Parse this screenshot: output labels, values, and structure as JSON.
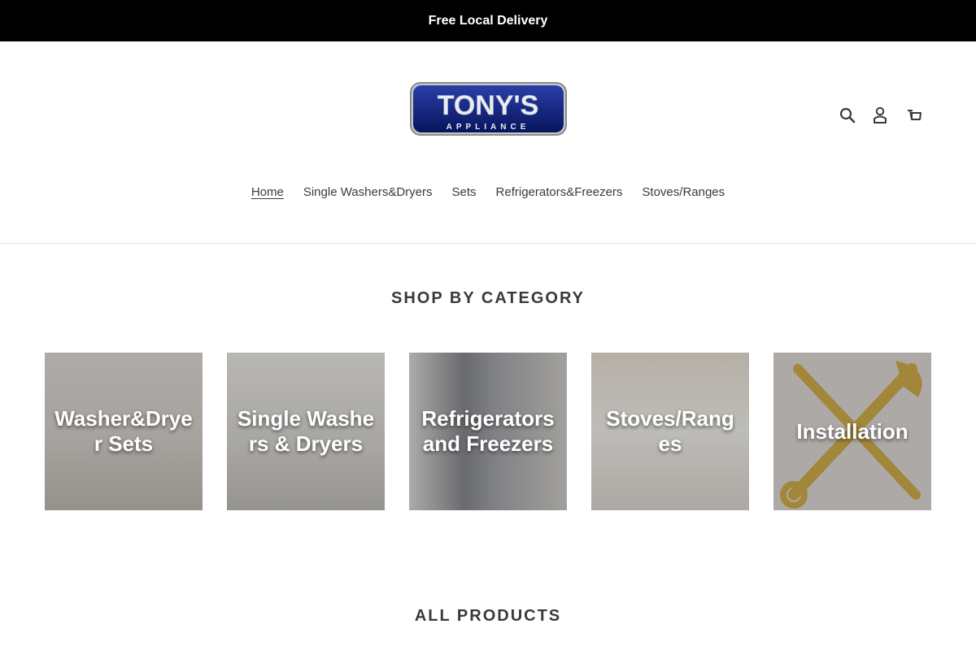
{
  "announcement": {
    "text": "Free Local Delivery"
  },
  "header": {
    "logo": {
      "main": "TONY'S",
      "sub": "APPLIANCE"
    },
    "icons": [
      "search-icon",
      "account-icon",
      "cart-icon"
    ]
  },
  "nav": {
    "items": [
      {
        "label": "Home",
        "active": true
      },
      {
        "label": "Single Washers&Dryers"
      },
      {
        "label": "Sets"
      },
      {
        "label": "Refrigerators&Freezers"
      },
      {
        "label": "Stoves/Ranges"
      }
    ]
  },
  "sections": {
    "shop_by_category": "SHOP BY CATEGORY",
    "all_products": "ALL PRODUCTS"
  },
  "categories": [
    {
      "label": "Washer&Dryer Sets"
    },
    {
      "label": "Single Washers & Dryers"
    },
    {
      "label": "Refrigerators and Freezers"
    },
    {
      "label": "Stoves/Ranges"
    },
    {
      "label": "Installation"
    }
  ],
  "colors": {
    "announcement_bg": "#000000",
    "logo_blue": "#0b1f7a",
    "text": "#3a3a3a"
  }
}
